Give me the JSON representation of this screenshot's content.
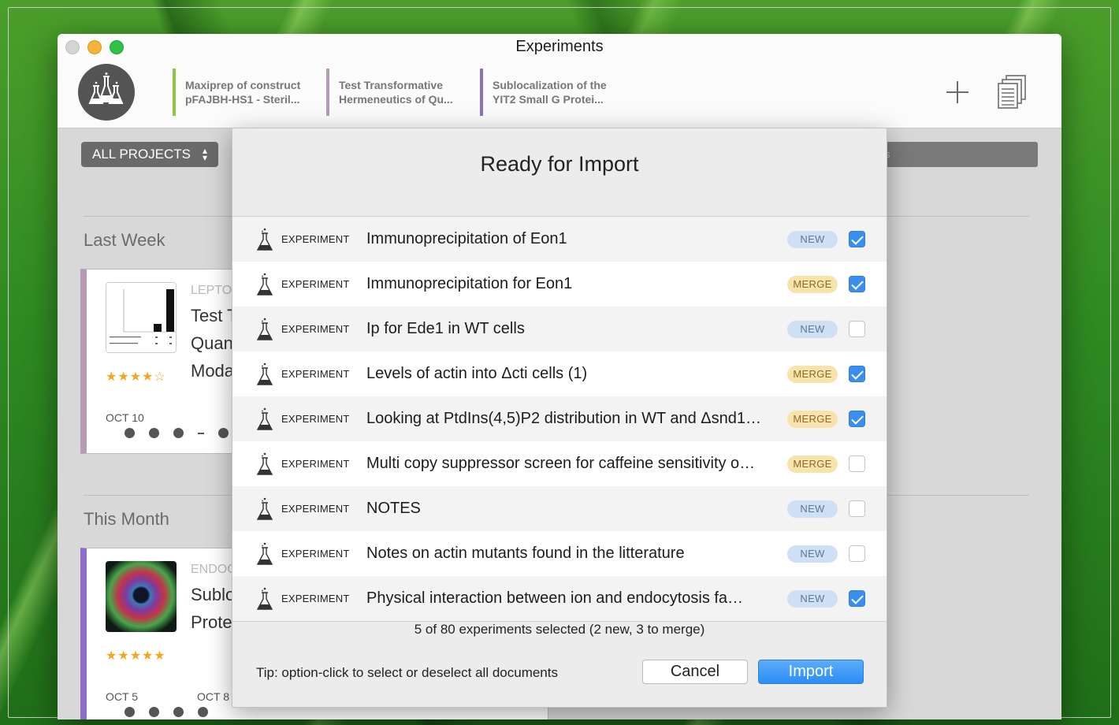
{
  "window": {
    "title": "Experiments"
  },
  "tabs": [
    {
      "line1": "Maxiprep of construct",
      "line2": "pFAJBH-HS1 - Steril...",
      "color": "#8dc63f"
    },
    {
      "line1": "Test Transformative",
      "line2": "Hermeneutics of Qu...",
      "color": "#b79bb5"
    },
    {
      "line1": "Sublocalization of the",
      "line2": "YIT2 Small G Protei...",
      "color": "#8f6ec8"
    }
  ],
  "toolbar": {
    "add_icon": "plus-icon",
    "docs_icon": "documents-icon"
  },
  "filter": {
    "label": "ALL PROJECTS",
    "icon": "up-down-chevron-icon"
  },
  "search": {
    "partial": "s"
  },
  "sections": [
    {
      "label": "Last Week",
      "card": {
        "project": "LEPTON",
        "title_lines": [
          "Test T",
          "Quant",
          "Moda"
        ],
        "stars": "★★★★☆",
        "rating": 4,
        "date": "OCT 10",
        "accent": "#b79bb5"
      }
    },
    {
      "label": "This Month",
      "card": {
        "project": "ENDOC",
        "title_lines": [
          "Subloc",
          "Protei"
        ],
        "stars": "★★★★★",
        "rating": 5,
        "date": "OCT 5",
        "date2": "OCT 8",
        "accent": "#8f6ec8"
      }
    }
  ],
  "modal": {
    "title": "Ready for Import",
    "rows": [
      {
        "kind": "EXPERIMENT",
        "title": "Immunoprecipitation of Eon1",
        "status": "NEW",
        "checked": true
      },
      {
        "kind": "EXPERIMENT",
        "title": "Immunoprecipitation for Eon1",
        "status": "MERGE",
        "checked": true
      },
      {
        "kind": "EXPERIMENT",
        "title": "Ip for Ede1 in WT cells",
        "status": "NEW",
        "checked": false
      },
      {
        "kind": "EXPERIMENT",
        "title": "Levels of actin into Δcti cells (1)",
        "status": "MERGE",
        "checked": true
      },
      {
        "kind": "EXPERIMENT",
        "title": "Looking at PtdIns(4,5)P2 distribution in WT and Δsnd1…",
        "status": "MERGE",
        "checked": true
      },
      {
        "kind": "EXPERIMENT",
        "title": "Multi copy suppressor screen for caffeine sensitivity o…",
        "status": "MERGE",
        "checked": false
      },
      {
        "kind": "EXPERIMENT",
        "title": "NOTES",
        "status": "NEW",
        "checked": false
      },
      {
        "kind": "EXPERIMENT",
        "title": "Notes on actin mutants found in the litterature",
        "status": "NEW",
        "checked": false
      },
      {
        "kind": "EXPERIMENT",
        "title": "Physical interaction between ion and endocytosis fa…",
        "status": "NEW",
        "checked": true
      }
    ],
    "summary": "5 of 80 experiments selected (2 new, 3 to merge)",
    "tip": "Tip: option-click to select or deselect all documents",
    "cancel_label": "Cancel",
    "import_label": "Import"
  },
  "colors": {
    "accent_blue": "#3a8ef0",
    "new_badge": "#cfe0f4",
    "merge_badge": "#f8e3ad"
  }
}
